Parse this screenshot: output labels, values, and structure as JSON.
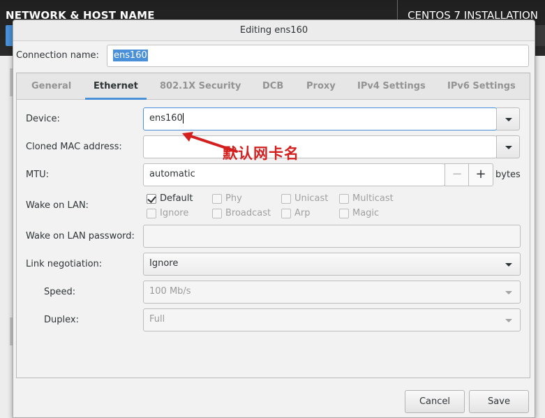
{
  "background": {
    "section_title": "NETWORK & HOST NAME",
    "installer_title": "CENTOS 7 INSTALLATION"
  },
  "dialog": {
    "title": "Editing ens160",
    "connection_name_label": "Connection name:",
    "connection_name_value": "ens160",
    "tabs": [
      "General",
      "Ethernet",
      "802.1X Security",
      "DCB",
      "Proxy",
      "IPv4 Settings",
      "IPv6 Settings"
    ],
    "active_tab": "Ethernet",
    "ethernet": {
      "device_label": "Device:",
      "device_value": "ens160",
      "cloned_mac_label": "Cloned MAC address:",
      "cloned_mac_value": "",
      "mtu_label": "MTU:",
      "mtu_value": "automatic",
      "mtu_minus": "−",
      "mtu_plus": "+",
      "mtu_unit": "bytes",
      "wake_on_lan_label": "Wake on LAN:",
      "wake_on_lan_options": [
        {
          "label": "Default",
          "checked": true
        },
        {
          "label": "Phy",
          "checked": false
        },
        {
          "label": "Unicast",
          "checked": false
        },
        {
          "label": "Multicast",
          "checked": false
        },
        {
          "label": "Ignore",
          "checked": false
        },
        {
          "label": "Broadcast",
          "checked": false
        },
        {
          "label": "Arp",
          "checked": false
        },
        {
          "label": "Magic",
          "checked": false
        }
      ],
      "wol_password_label": "Wake on LAN password:",
      "wol_password_value": "",
      "link_negotiation_label": "Link negotiation:",
      "link_negotiation_value": "Ignore",
      "speed_label": "Speed:",
      "speed_value": "100 Mb/s",
      "duplex_label": "Duplex:",
      "duplex_value": "Full"
    },
    "annotation_text": "默认网卡名",
    "cancel_label": "Cancel",
    "save_label": "Save"
  },
  "colors": {
    "accent": "#4a90d9",
    "annotation": "#d41f1f"
  }
}
